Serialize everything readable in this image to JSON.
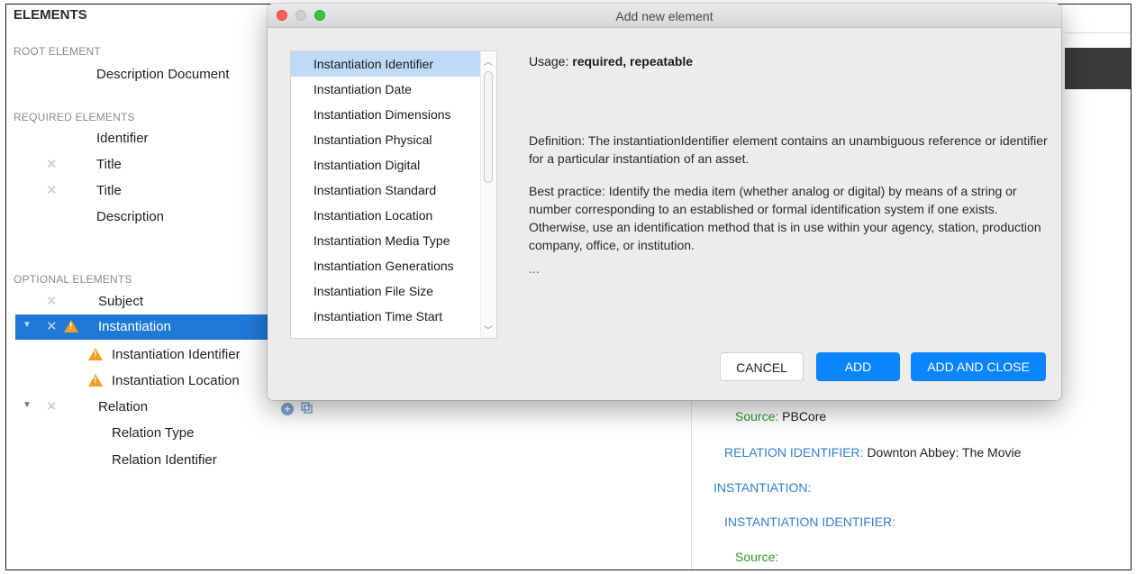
{
  "left_panel": {
    "title": "ELEMENTS",
    "sections": {
      "root": "ROOT ELEMENT",
      "required": "REQUIRED ELEMENTS",
      "optional": "OPTIONAL ELEMENTS"
    },
    "root_items": [
      "Description Document"
    ],
    "required_items": [
      "Identifier",
      "Title",
      "Title",
      "Description"
    ],
    "optional_items": [
      "Subject",
      "Instantiation",
      "Instantiation Identifier",
      "Instantiation Location",
      "Relation",
      "Relation Type",
      "Relation Identifier"
    ]
  },
  "preview": {
    "source_label": "Source:",
    "source_value": "PBCore",
    "relation_identifier_label": "RELATION IDENTIFIER:",
    "relation_identifier_value": "Downton Abbey: The Movie",
    "instantiation_label": "INSTANTIATION:",
    "instantiation_identifier_label": "INSTANTIATION IDENTIFIER:",
    "source2_label": "Source:"
  },
  "dialog": {
    "title": "Add new element",
    "list": [
      "Instantiation Identifier",
      "Instantiation Date",
      "Instantiation Dimensions",
      "Instantiation Physical",
      "Instantiation Digital",
      "Instantiation Standard",
      "Instantiation Location",
      "Instantiation Media Type",
      "Instantiation Generations",
      "Instantiation File Size",
      "Instantiation Time Start"
    ],
    "selected_index": 0,
    "usage_label": "Usage:",
    "usage_value": "required, repeatable",
    "definition": "Definition: The instantiationIdentifier element contains an unambiguous reference or identifier for a particular instantiation of an asset.",
    "best_practice": "Best practice: Identify the media item (whether analog or digital) by means of a string or number corresponding to an established or formal identification system if one exists. Otherwise, use an identification method that is in use within your agency, station, production company, office, or institution.",
    "ellipsis": "...",
    "buttons": {
      "cancel": "CANCEL",
      "add": "ADD",
      "add_close": "ADD AND CLOSE"
    }
  },
  "colors": {
    "selection": "#1f7ad6",
    "warning": "#f29d22",
    "primary_button": "#0a84ff",
    "preview_blue": "#2f7fd0",
    "preview_green": "#2d9a2d"
  }
}
